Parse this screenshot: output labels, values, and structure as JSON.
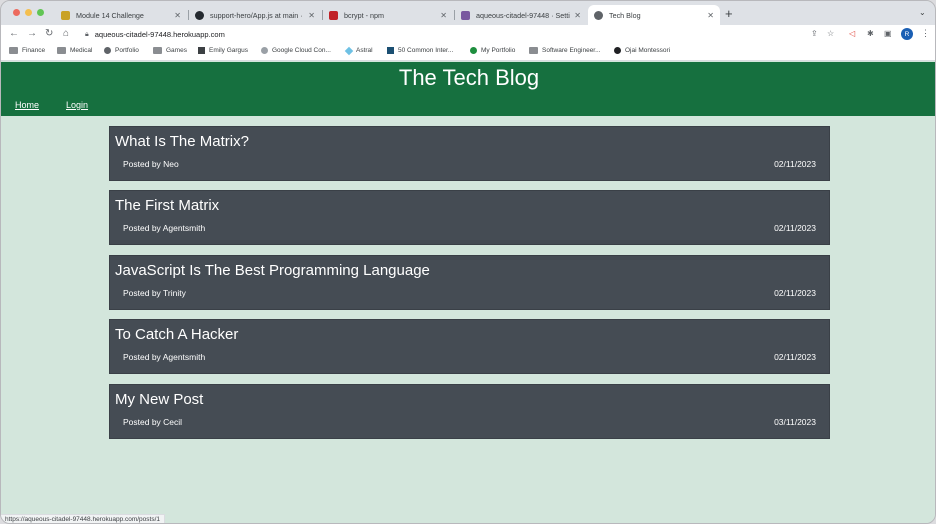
{
  "browser": {
    "tabs": [
      {
        "label": "Module 14 Challenge",
        "favicon_color": "#c9a227"
      },
      {
        "label": "support-hero/App.js at main ·",
        "favicon_color": "#24292f"
      },
      {
        "label": "bcrypt - npm",
        "favicon_color": "#c12127"
      },
      {
        "label": "aqueous-citadel-97448 · Setti",
        "favicon_color": "#79589f"
      },
      {
        "label": "Tech Blog",
        "favicon_color": "#5f6368",
        "active": true
      }
    ],
    "url": "aqueous-citadel-97448.herokuapp.com",
    "profile_initial": "R",
    "bookmarks": [
      {
        "label": "Finance",
        "icon": "folder-icon"
      },
      {
        "label": "Medical",
        "icon": "folder-icon"
      },
      {
        "label": "Portfolio",
        "icon": "globe-icon"
      },
      {
        "label": "Games",
        "icon": "folder-icon"
      },
      {
        "label": "Emily Gargus",
        "icon": "cube-icon"
      },
      {
        "label": "Google Cloud Con...",
        "icon": "gear-icon"
      },
      {
        "label": "Astral",
        "icon": "diamond-icon"
      },
      {
        "label": "50 Common Inter...",
        "icon": "chart-icon"
      },
      {
        "label": "My Portfolio",
        "icon": "green-circle-icon"
      },
      {
        "label": "Software Engineer...",
        "icon": "folder-icon"
      },
      {
        "label": "Ojai Montessori",
        "icon": "montessori-icon"
      }
    ],
    "status_url": "https://aqueous-citadel-97448.herokuapp.com/posts/1"
  },
  "site": {
    "title": "The Tech Blog",
    "nav": {
      "home": "Home",
      "login": "Login"
    },
    "header_color": "#16703f",
    "background_color": "#d3e6dc",
    "card_color": "#454c54"
  },
  "posts": [
    {
      "title": "What Is The Matrix?",
      "author": "Posted by Neo",
      "date": "02/11/2023"
    },
    {
      "title": "The First Matrix",
      "author": "Posted by Agentsmith",
      "date": "02/11/2023"
    },
    {
      "title": "JavaScript Is The Best Programming Language",
      "author": "Posted by Trinity",
      "date": "02/11/2023"
    },
    {
      "title": "To Catch A Hacker",
      "author": "Posted by Agentsmith",
      "date": "02/11/2023"
    },
    {
      "title": "My New Post",
      "author": "Posted by Cecil",
      "date": "03/11/2023"
    }
  ]
}
